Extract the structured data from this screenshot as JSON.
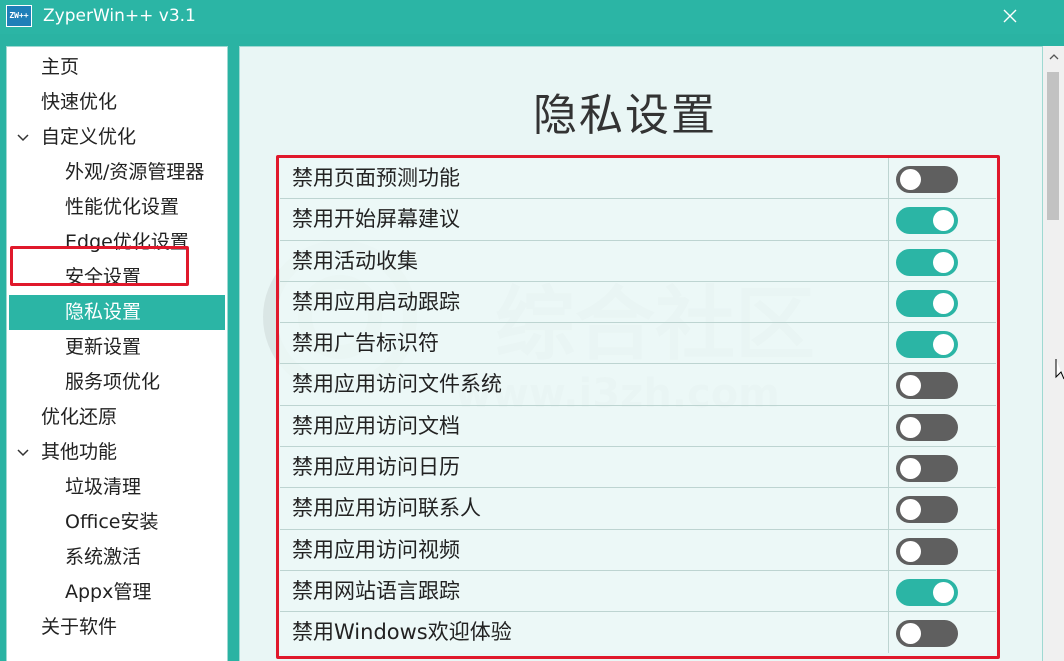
{
  "window": {
    "title": "ZyperWin++ v3.1",
    "icon_text": "ZW++",
    "close_icon": "close-icon"
  },
  "sidebar": {
    "items": [
      {
        "label": "主页",
        "level": 0,
        "expandable": false,
        "selected": false
      },
      {
        "label": "快速优化",
        "level": 0,
        "expandable": false,
        "selected": false
      },
      {
        "label": "自定义优化",
        "level": 0,
        "expandable": true,
        "selected": false
      },
      {
        "label": "外观/资源管理器",
        "level": 1,
        "expandable": false,
        "selected": false
      },
      {
        "label": "性能优化设置",
        "level": 1,
        "expandable": false,
        "selected": false
      },
      {
        "label": "Edge优化设置",
        "level": 1,
        "expandable": false,
        "selected": false
      },
      {
        "label": "安全设置",
        "level": 1,
        "expandable": false,
        "selected": false
      },
      {
        "label": "隐私设置",
        "level": 1,
        "expandable": false,
        "selected": true
      },
      {
        "label": "更新设置",
        "level": 1,
        "expandable": false,
        "selected": false
      },
      {
        "label": "服务项优化",
        "level": 1,
        "expandable": false,
        "selected": false
      },
      {
        "label": "优化还原",
        "level": 0,
        "expandable": false,
        "selected": false
      },
      {
        "label": "其他功能",
        "level": 0,
        "expandable": true,
        "selected": false
      },
      {
        "label": "垃圾清理",
        "level": 1,
        "expandable": false,
        "selected": false
      },
      {
        "label": "Office安装",
        "level": 1,
        "expandable": false,
        "selected": false
      },
      {
        "label": "系统激活",
        "level": 1,
        "expandable": false,
        "selected": false
      },
      {
        "label": "Appx管理",
        "level": 1,
        "expandable": false,
        "selected": false
      },
      {
        "label": "关于软件",
        "level": 0,
        "expandable": false,
        "selected": false
      }
    ]
  },
  "main": {
    "title": "隐私设置",
    "watermark_text": "综合社区",
    "watermark_url": "www.i3zh.com",
    "settings": [
      {
        "label": "禁用页面预测功能",
        "enabled": false
      },
      {
        "label": "禁用开始屏幕建议",
        "enabled": true
      },
      {
        "label": "禁用活动收集",
        "enabled": true
      },
      {
        "label": "禁用应用启动跟踪",
        "enabled": true
      },
      {
        "label": "禁用广告标识符",
        "enabled": true
      },
      {
        "label": "禁用应用访问文件系统",
        "enabled": false
      },
      {
        "label": "禁用应用访问文档",
        "enabled": false
      },
      {
        "label": "禁用应用访问日历",
        "enabled": false
      },
      {
        "label": "禁用应用访问联系人",
        "enabled": false
      },
      {
        "label": "禁用应用访问视频",
        "enabled": false
      },
      {
        "label": "禁用网站语言跟踪",
        "enabled": true
      },
      {
        "label": "禁用Windows欢迎体验",
        "enabled": false
      }
    ]
  },
  "colors": {
    "accent": "#2bb5a5",
    "toggle_off": "#5f5f5f",
    "highlight_box": "#e0182b",
    "panel_bg": "#e9f6f5"
  }
}
